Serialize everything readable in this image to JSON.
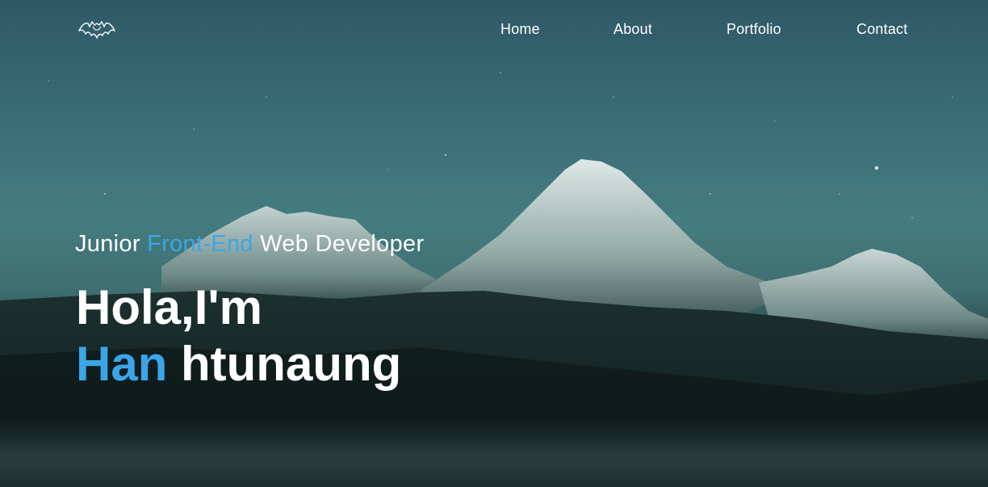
{
  "nav": {
    "logo_icon": "bat-logo-icon",
    "links": [
      {
        "label": "Home"
      },
      {
        "label": "About"
      },
      {
        "label": "Portfolio"
      },
      {
        "label": "Contact"
      }
    ]
  },
  "hero": {
    "subtitle": {
      "part1": "Junior ",
      "part2": "Front-End",
      "part3": " Web Developer"
    },
    "greeting": "Hola,I'm",
    "name_first": "Han",
    "name_rest": " htunaung"
  },
  "colors": {
    "accent": "#3aa6e9",
    "text": "#ffffff",
    "sky_top": "#2f5866",
    "sky_mid": "#457c80",
    "ground": "#142526"
  }
}
